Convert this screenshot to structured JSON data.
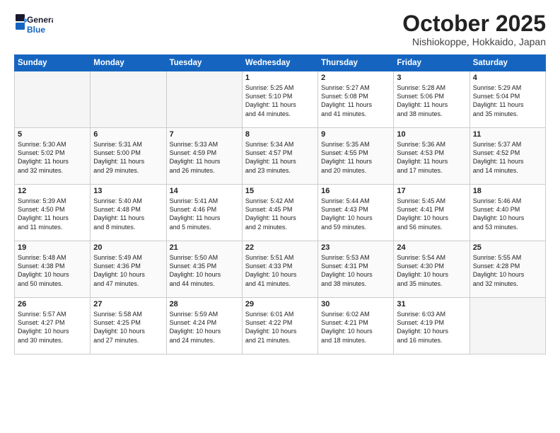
{
  "logo": {
    "line1": "General",
    "line2": "Blue"
  },
  "title": "October 2025",
  "subtitle": "Nishiokoppe, Hokkaido, Japan",
  "days_header": [
    "Sunday",
    "Monday",
    "Tuesday",
    "Wednesday",
    "Thursday",
    "Friday",
    "Saturday"
  ],
  "weeks": [
    [
      {
        "day": "",
        "text": ""
      },
      {
        "day": "",
        "text": ""
      },
      {
        "day": "",
        "text": ""
      },
      {
        "day": "1",
        "text": "Sunrise: 5:25 AM\nSunset: 5:10 PM\nDaylight: 11 hours\nand 44 minutes."
      },
      {
        "day": "2",
        "text": "Sunrise: 5:27 AM\nSunset: 5:08 PM\nDaylight: 11 hours\nand 41 minutes."
      },
      {
        "day": "3",
        "text": "Sunrise: 5:28 AM\nSunset: 5:06 PM\nDaylight: 11 hours\nand 38 minutes."
      },
      {
        "day": "4",
        "text": "Sunrise: 5:29 AM\nSunset: 5:04 PM\nDaylight: 11 hours\nand 35 minutes."
      }
    ],
    [
      {
        "day": "5",
        "text": "Sunrise: 5:30 AM\nSunset: 5:02 PM\nDaylight: 11 hours\nand 32 minutes."
      },
      {
        "day": "6",
        "text": "Sunrise: 5:31 AM\nSunset: 5:00 PM\nDaylight: 11 hours\nand 29 minutes."
      },
      {
        "day": "7",
        "text": "Sunrise: 5:33 AM\nSunset: 4:59 PM\nDaylight: 11 hours\nand 26 minutes."
      },
      {
        "day": "8",
        "text": "Sunrise: 5:34 AM\nSunset: 4:57 PM\nDaylight: 11 hours\nand 23 minutes."
      },
      {
        "day": "9",
        "text": "Sunrise: 5:35 AM\nSunset: 4:55 PM\nDaylight: 11 hours\nand 20 minutes."
      },
      {
        "day": "10",
        "text": "Sunrise: 5:36 AM\nSunset: 4:53 PM\nDaylight: 11 hours\nand 17 minutes."
      },
      {
        "day": "11",
        "text": "Sunrise: 5:37 AM\nSunset: 4:52 PM\nDaylight: 11 hours\nand 14 minutes."
      }
    ],
    [
      {
        "day": "12",
        "text": "Sunrise: 5:39 AM\nSunset: 4:50 PM\nDaylight: 11 hours\nand 11 minutes."
      },
      {
        "day": "13",
        "text": "Sunrise: 5:40 AM\nSunset: 4:48 PM\nDaylight: 11 hours\nand 8 minutes."
      },
      {
        "day": "14",
        "text": "Sunrise: 5:41 AM\nSunset: 4:46 PM\nDaylight: 11 hours\nand 5 minutes."
      },
      {
        "day": "15",
        "text": "Sunrise: 5:42 AM\nSunset: 4:45 PM\nDaylight: 11 hours\nand 2 minutes."
      },
      {
        "day": "16",
        "text": "Sunrise: 5:44 AM\nSunset: 4:43 PM\nDaylight: 10 hours\nand 59 minutes."
      },
      {
        "day": "17",
        "text": "Sunrise: 5:45 AM\nSunset: 4:41 PM\nDaylight: 10 hours\nand 56 minutes."
      },
      {
        "day": "18",
        "text": "Sunrise: 5:46 AM\nSunset: 4:40 PM\nDaylight: 10 hours\nand 53 minutes."
      }
    ],
    [
      {
        "day": "19",
        "text": "Sunrise: 5:48 AM\nSunset: 4:38 PM\nDaylight: 10 hours\nand 50 minutes."
      },
      {
        "day": "20",
        "text": "Sunrise: 5:49 AM\nSunset: 4:36 PM\nDaylight: 10 hours\nand 47 minutes."
      },
      {
        "day": "21",
        "text": "Sunrise: 5:50 AM\nSunset: 4:35 PM\nDaylight: 10 hours\nand 44 minutes."
      },
      {
        "day": "22",
        "text": "Sunrise: 5:51 AM\nSunset: 4:33 PM\nDaylight: 10 hours\nand 41 minutes."
      },
      {
        "day": "23",
        "text": "Sunrise: 5:53 AM\nSunset: 4:31 PM\nDaylight: 10 hours\nand 38 minutes."
      },
      {
        "day": "24",
        "text": "Sunrise: 5:54 AM\nSunset: 4:30 PM\nDaylight: 10 hours\nand 35 minutes."
      },
      {
        "day": "25",
        "text": "Sunrise: 5:55 AM\nSunset: 4:28 PM\nDaylight: 10 hours\nand 32 minutes."
      }
    ],
    [
      {
        "day": "26",
        "text": "Sunrise: 5:57 AM\nSunset: 4:27 PM\nDaylight: 10 hours\nand 30 minutes."
      },
      {
        "day": "27",
        "text": "Sunrise: 5:58 AM\nSunset: 4:25 PM\nDaylight: 10 hours\nand 27 minutes."
      },
      {
        "day": "28",
        "text": "Sunrise: 5:59 AM\nSunset: 4:24 PM\nDaylight: 10 hours\nand 24 minutes."
      },
      {
        "day": "29",
        "text": "Sunrise: 6:01 AM\nSunset: 4:22 PM\nDaylight: 10 hours\nand 21 minutes."
      },
      {
        "day": "30",
        "text": "Sunrise: 6:02 AM\nSunset: 4:21 PM\nDaylight: 10 hours\nand 18 minutes."
      },
      {
        "day": "31",
        "text": "Sunrise: 6:03 AM\nSunset: 4:19 PM\nDaylight: 10 hours\nand 16 minutes."
      },
      {
        "day": "",
        "text": ""
      }
    ]
  ]
}
